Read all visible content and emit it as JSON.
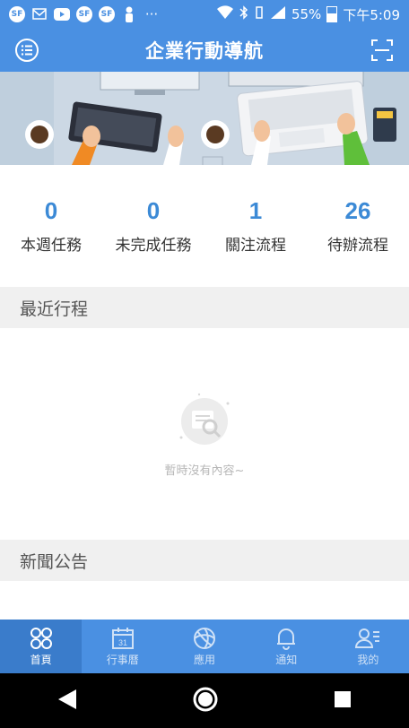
{
  "status_bar": {
    "battery_percent": "55%",
    "time": "下午5:09",
    "network": "4G"
  },
  "app_bar": {
    "title": "企業行動導航",
    "left_icon": "menu-list-icon",
    "right_icon": "scan-icon"
  },
  "stats": [
    {
      "value": "0",
      "label": "本週任務"
    },
    {
      "value": "0",
      "label": "未完成任務"
    },
    {
      "value": "1",
      "label": "關注流程"
    },
    {
      "value": "26",
      "label": "待辦流程"
    }
  ],
  "recent_schedule": {
    "title": "最近行程",
    "empty_text": "暫時沒有內容~"
  },
  "news": {
    "title": "新聞公告"
  },
  "bottom_nav": [
    {
      "label": "首頁",
      "icon": "home-icon",
      "active": true
    },
    {
      "label": "行事曆",
      "icon": "calendar-icon",
      "active": false
    },
    {
      "label": "應用",
      "icon": "apps-icon",
      "active": false
    },
    {
      "label": "通知",
      "icon": "bell-icon",
      "active": false
    },
    {
      "label": "我的",
      "icon": "profile-icon",
      "active": false
    }
  ],
  "colors": {
    "primary": "#4a90e2",
    "active_tab": "#3a7ccb",
    "stat_number": "#3c8ad6",
    "section_bg": "#f0f0f0"
  }
}
